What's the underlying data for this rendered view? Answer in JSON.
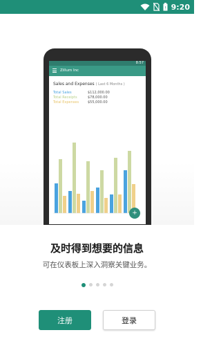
{
  "status_bar": {
    "time": "9:20",
    "icons": [
      "wifi-icon",
      "no-sim-icon",
      "battery-icon"
    ]
  },
  "illustration": {
    "phone_time": "8:57",
    "app_title": "Zillum Inc",
    "report_title": "Sales and Expenses",
    "report_period": "( Last 6 Months )",
    "legend": [
      {
        "label": "Total Sales",
        "value": "$112,000.00",
        "color": "#4aa3df"
      },
      {
        "label": "Total Receipts",
        "value": "$78,000.00",
        "color": "#b8d08a"
      },
      {
        "label": "Total Expenses",
        "value": "$55,000.00",
        "color": "#e8c46a"
      }
    ],
    "fab_label": "+"
  },
  "onboarding": {
    "headline": "及时得到想要的信息",
    "subline": "可在仪表板上深入洞察关键业务。",
    "page_count": 5,
    "active_page": 1
  },
  "actions": {
    "register_label": "注册",
    "login_label": "登录"
  },
  "colors": {
    "brand": "#1f8f78",
    "accent_blue": "#4aa3df",
    "accent_green": "#b8d08a",
    "accent_yellow": "#e8c46a"
  }
}
